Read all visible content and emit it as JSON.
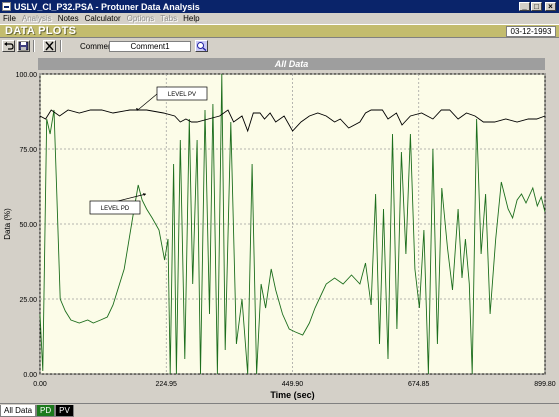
{
  "window": {
    "title": "USLV_CI_P32.PSA - Protuner Data  Analysis",
    "app_icon": "app-icon",
    "controls": {
      "minimize": "_",
      "maximize": "□",
      "close": "×"
    }
  },
  "menu": [
    {
      "label": "File",
      "enabled": true
    },
    {
      "label": "Analysis",
      "enabled": false
    },
    {
      "label": "Notes",
      "enabled": true
    },
    {
      "label": "Calculator",
      "enabled": true
    },
    {
      "label": "Options",
      "enabled": false
    },
    {
      "label": "Tabs",
      "enabled": false
    },
    {
      "label": "Help",
      "enabled": true
    }
  ],
  "header": {
    "title": "DATA PLOTS",
    "date": "03-12-1993",
    "banner_color": "#c3bc6e"
  },
  "toolbar": {
    "comment_label": "Comment",
    "comment_value": "Comment1",
    "icons": [
      "undo-icon",
      "save-icon",
      "close-icon",
      "zoom-icon"
    ]
  },
  "plot": {
    "title": "All Data",
    "ylabel": "Data (%)",
    "xlabel": "Time (sec)",
    "yticks": [
      "100.00",
      "75.00",
      "50.00",
      "25.00",
      "0.00"
    ],
    "xticks": [
      "0.00",
      "224.95",
      "449.90",
      "674.85",
      "899.80"
    ],
    "annotations": {
      "pv": "LEVEL PV",
      "pd": "LEVEL PD"
    }
  },
  "chart_data": {
    "type": "line",
    "title": "All Data",
    "xlabel": "Time (sec)",
    "ylabel": "Data (%)",
    "xlim": [
      0,
      899.8
    ],
    "ylim": [
      0,
      100
    ],
    "grid": true,
    "background": "#fcfce8",
    "series": [
      {
        "name": "LEVEL PV",
        "color": "#000000",
        "points": [
          [
            0,
            86
          ],
          [
            10,
            85
          ],
          [
            20,
            88
          ],
          [
            35,
            86
          ],
          [
            50,
            88
          ],
          [
            70,
            87
          ],
          [
            90,
            88
          ],
          [
            110,
            88
          ],
          [
            130,
            87
          ],
          [
            160,
            88
          ],
          [
            190,
            88
          ],
          [
            220,
            87
          ],
          [
            240,
            86
          ],
          [
            250,
            84
          ],
          [
            260,
            85
          ],
          [
            270,
            84
          ],
          [
            280,
            84
          ],
          [
            300,
            85
          ],
          [
            320,
            86
          ],
          [
            335,
            88
          ],
          [
            345,
            84
          ],
          [
            360,
            86
          ],
          [
            370,
            81
          ],
          [
            380,
            87
          ],
          [
            392,
            87
          ],
          [
            400,
            85
          ],
          [
            410,
            87
          ],
          [
            420,
            84
          ],
          [
            435,
            86
          ],
          [
            450,
            81
          ],
          [
            465,
            84
          ],
          [
            480,
            86
          ],
          [
            495,
            87
          ],
          [
            510,
            86
          ],
          [
            525,
            84
          ],
          [
            535,
            85
          ],
          [
            550,
            82
          ],
          [
            570,
            84
          ],
          [
            580,
            87
          ],
          [
            590,
            88
          ],
          [
            610,
            88
          ],
          [
            620,
            85
          ],
          [
            635,
            87
          ],
          [
            645,
            83
          ],
          [
            660,
            86
          ],
          [
            680,
            87
          ],
          [
            700,
            85
          ],
          [
            715,
            88
          ],
          [
            730,
            88
          ],
          [
            745,
            85
          ],
          [
            760,
            87
          ],
          [
            775,
            86
          ],
          [
            790,
            84
          ],
          [
            810,
            84
          ],
          [
            830,
            85
          ],
          [
            850,
            84
          ],
          [
            870,
            85
          ],
          [
            885,
            85
          ],
          [
            899.8,
            86
          ]
        ]
      },
      {
        "name": "LEVEL PD",
        "color": "#1d6e1d",
        "points": [
          [
            0,
            20
          ],
          [
            5,
            1
          ],
          [
            12,
            85
          ],
          [
            18,
            80
          ],
          [
            25,
            88
          ],
          [
            30,
            60
          ],
          [
            36,
            25
          ],
          [
            45,
            21
          ],
          [
            55,
            18
          ],
          [
            70,
            17
          ],
          [
            85,
            18
          ],
          [
            95,
            17
          ],
          [
            108,
            18
          ],
          [
            120,
            19
          ],
          [
            130,
            23
          ],
          [
            150,
            35
          ],
          [
            165,
            52
          ],
          [
            175,
            63
          ],
          [
            182,
            58
          ],
          [
            190,
            55
          ],
          [
            200,
            52
          ],
          [
            212,
            48
          ],
          [
            222,
            38
          ],
          [
            228,
            45
          ],
          [
            232,
            0
          ],
          [
            238,
            70
          ],
          [
            243,
            0
          ],
          [
            250,
            78
          ],
          [
            258,
            5
          ],
          [
            266,
            85
          ],
          [
            272,
            30
          ],
          [
            280,
            78
          ],
          [
            286,
            0
          ],
          [
            294,
            88
          ],
          [
            302,
            20
          ],
          [
            308,
            90
          ],
          [
            316,
            0
          ],
          [
            324,
            100
          ],
          [
            330,
            8
          ],
          [
            340,
            84
          ],
          [
            350,
            10
          ],
          [
            360,
            25
          ],
          [
            370,
            0
          ],
          [
            378,
            70
          ],
          [
            386,
            0
          ],
          [
            394,
            30
          ],
          [
            402,
            22
          ],
          [
            412,
            35
          ],
          [
            420,
            28
          ],
          [
            432,
            20
          ],
          [
            444,
            15
          ],
          [
            455,
            14
          ],
          [
            468,
            13
          ],
          [
            480,
            17
          ],
          [
            490,
            22
          ],
          [
            500,
            26
          ],
          [
            510,
            30
          ],
          [
            525,
            32
          ],
          [
            540,
            30
          ],
          [
            555,
            33
          ],
          [
            570,
            30
          ],
          [
            580,
            37
          ],
          [
            590,
            23
          ],
          [
            598,
            60
          ],
          [
            605,
            10
          ],
          [
            612,
            55
          ],
          [
            620,
            5
          ],
          [
            628,
            80
          ],
          [
            636,
            15
          ],
          [
            644,
            74
          ],
          [
            652,
            40
          ],
          [
            660,
            80
          ],
          [
            668,
            35
          ],
          [
            676,
            22
          ],
          [
            684,
            48
          ],
          [
            692,
            0
          ],
          [
            700,
            75
          ],
          [
            708,
            10
          ],
          [
            716,
            62
          ],
          [
            726,
            42
          ],
          [
            735,
            28
          ],
          [
            745,
            55
          ],
          [
            752,
            32
          ],
          [
            758,
            45
          ],
          [
            765,
            30
          ],
          [
            770,
            0
          ],
          [
            778,
            85
          ],
          [
            786,
            40
          ],
          [
            794,
            60
          ],
          [
            802,
            20
          ],
          [
            812,
            45
          ],
          [
            822,
            64
          ],
          [
            834,
            55
          ],
          [
            842,
            52
          ],
          [
            850,
            58
          ],
          [
            858,
            60
          ],
          [
            866,
            57
          ],
          [
            878,
            62
          ],
          [
            886,
            56
          ],
          [
            893,
            59
          ],
          [
            899.8,
            54
          ]
        ]
      }
    ]
  },
  "tabs": [
    {
      "label": "All Data",
      "active": true
    },
    {
      "label": "PD",
      "color": "#1d7a1d"
    },
    {
      "label": "PV",
      "color": "#000000"
    }
  ]
}
